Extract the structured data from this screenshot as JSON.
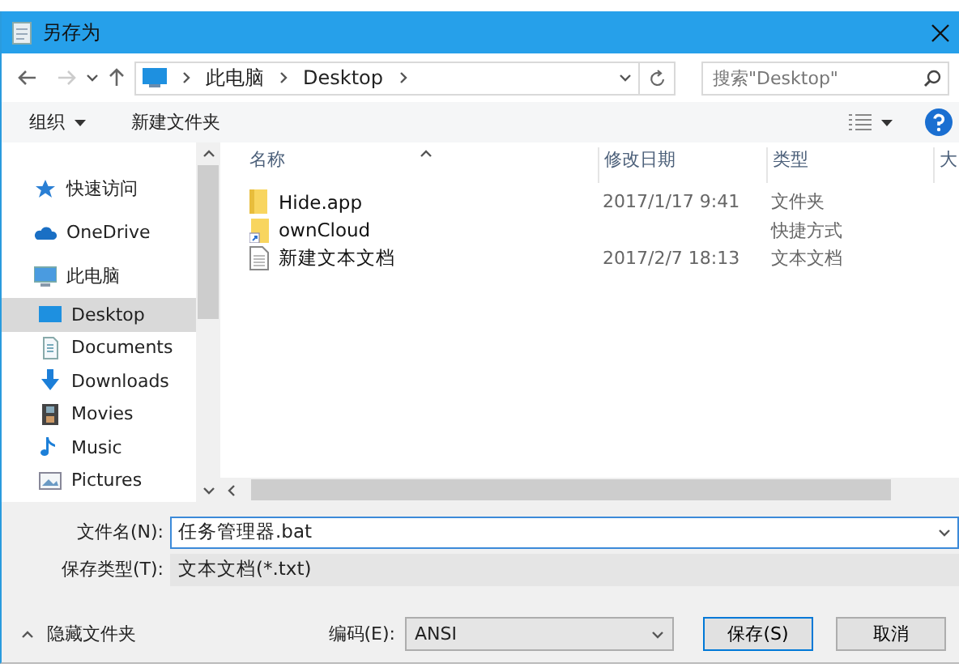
{
  "window": {
    "title": "另存为"
  },
  "address": {
    "path": [
      "此电脑",
      "Desktop"
    ],
    "search_placeholder": "搜索\"Desktop\""
  },
  "toolbar": {
    "organize": "组织",
    "new_folder": "新建文件夹"
  },
  "sidebar": {
    "items": [
      {
        "label": "快速访问",
        "kind": "quick",
        "selected": false
      },
      {
        "label": "OneDrive",
        "kind": "cloud",
        "selected": false
      },
      {
        "label": "此电脑",
        "kind": "pc",
        "selected": false,
        "children": [
          {
            "label": "Desktop",
            "kind": "desktop",
            "selected": true
          },
          {
            "label": "Documents",
            "kind": "documents",
            "selected": false
          },
          {
            "label": "Downloads",
            "kind": "downloads",
            "selected": false
          },
          {
            "label": "Movies",
            "kind": "movies",
            "selected": false
          },
          {
            "label": "Music",
            "kind": "music",
            "selected": false
          },
          {
            "label": "Pictures",
            "kind": "pictures",
            "selected": false
          }
        ]
      }
    ]
  },
  "table": {
    "columns": [
      "名称",
      "修改日期",
      "类型",
      "大"
    ],
    "rows": [
      {
        "kind": "folder",
        "name": "Hide.app",
        "date": "2017/1/17 9:41",
        "type": "文件夹"
      },
      {
        "kind": "shortcut",
        "name": "ownCloud",
        "type": "快捷方式"
      },
      {
        "kind": "text",
        "name": "新建文本文档",
        "date": "2017/2/7 18:13",
        "type": "文本文档"
      }
    ]
  },
  "save": {
    "filename_label": "文件名(N):",
    "filename": "任务管理器.bat",
    "type_label": "保存类型(T):",
    "type_value": "文本文档(*.txt)",
    "hide_folders": "隐藏文件夹",
    "encoding_label": "编码(E):",
    "encoding": "ANSI",
    "buttons": [
      "保存(S)",
      "取消"
    ]
  }
}
